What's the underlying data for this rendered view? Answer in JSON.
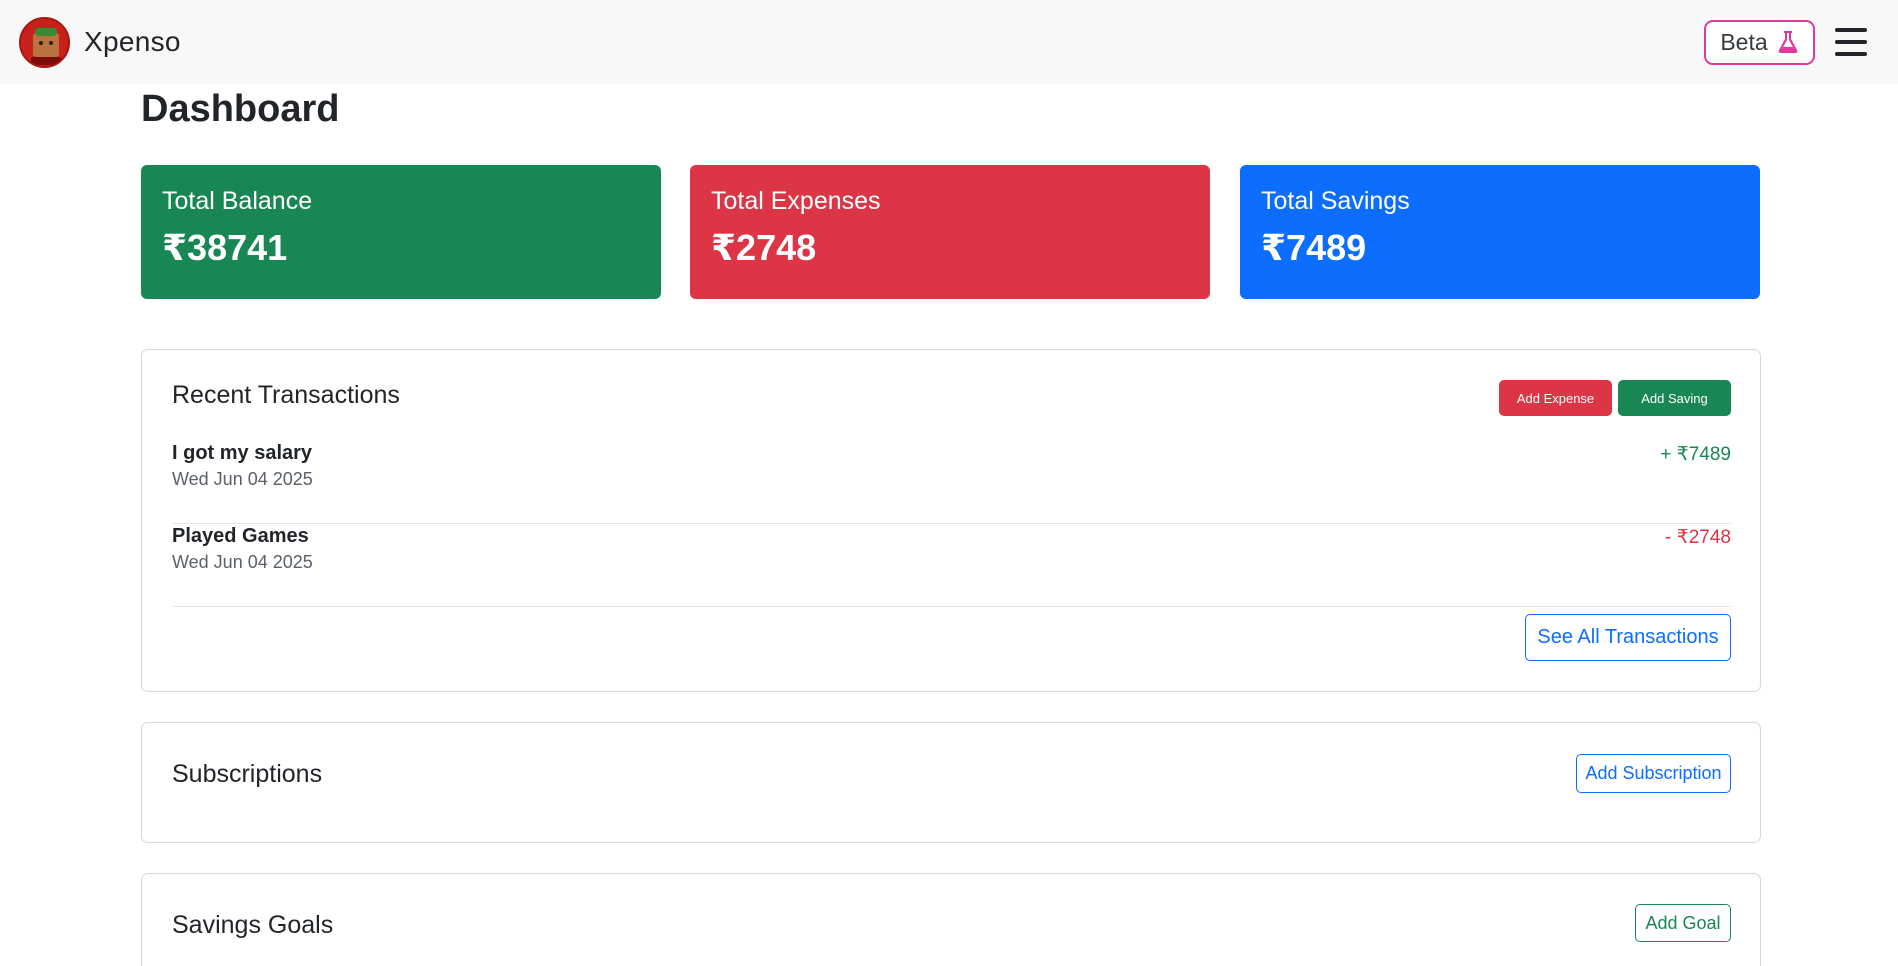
{
  "header": {
    "brand": "Xpenso",
    "beta_label": "Beta",
    "beta_icon": "flask-icon",
    "menu_icon": "hamburger-menu-icon"
  },
  "page": {
    "title": "Dashboard"
  },
  "stats": {
    "balance": {
      "label": "Total Balance",
      "value": "₹38741",
      "color": "#198754"
    },
    "expenses": {
      "label": "Total Expenses",
      "value": "₹2748",
      "color": "#dc3545"
    },
    "savings": {
      "label": "Total Savings",
      "value": "₹7489",
      "color": "#0d6efd"
    }
  },
  "transactions": {
    "title": "Recent Transactions",
    "add_expense_label": "Add Expense",
    "add_saving_label": "Add Saving",
    "items": [
      {
        "name": "I got my salary",
        "date": "Wed Jun 04 2025",
        "amount": "+ ₹7489",
        "type": "saving"
      },
      {
        "name": "Played Games",
        "date": "Wed Jun 04 2025",
        "amount": "- ₹2748",
        "type": "expense"
      }
    ],
    "see_all_label": "See All Transactions"
  },
  "subscriptions": {
    "title": "Subscriptions",
    "add_label": "Add Subscription"
  },
  "goals": {
    "title": "Savings Goals",
    "add_label": "Add Goal"
  }
}
